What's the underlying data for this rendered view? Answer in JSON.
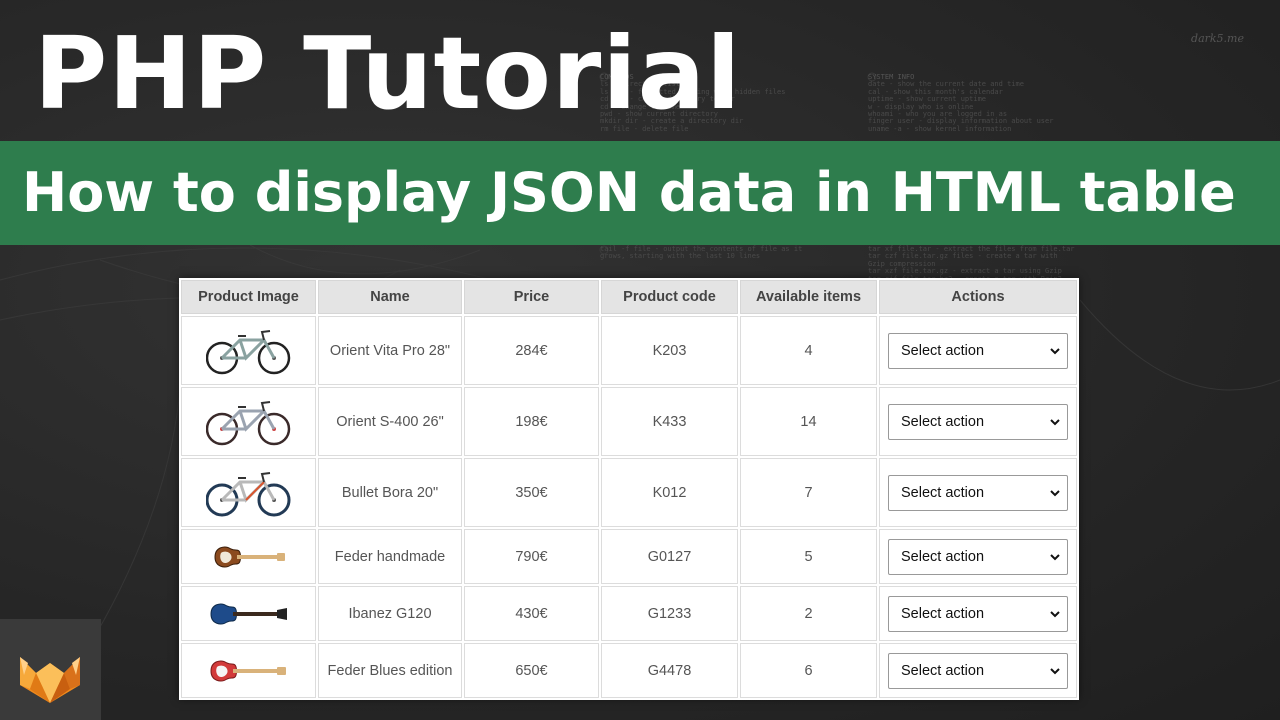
{
  "header": {
    "title": "PHP Tutorial",
    "subtitle": "How to display JSON data in HTML table",
    "banner_color": "#2e7d4d",
    "watermark": "dark5.me"
  },
  "background_cheatsheet": {
    "left_heading": "COMMANDS",
    "left_lines": [
      "ls - directory listing",
      "ls -al - formatted listing with hidden files",
      "cd dir - change directory to dir",
      "cd - change to home",
      "pwd - show current directory",
      "mkdir dir - create a directory dir",
      "rm file - delete file"
    ],
    "right_heading": "SYSTEM INFO",
    "right_lines": [
      "date - show the current date and time",
      "cal - show this month's calendar",
      "uptime - show current uptime",
      "w - display who is online",
      "whoami - who you are logged in as",
      "finger user - display information about user",
      "uname -a - show kernel information"
    ],
    "low_left_lines": [
      "tail -f file - output the contents of file as it",
      "grows, starting with the last 10 lines"
    ],
    "low_right_lines": [
      "tar xf file.tar - extract the files from file.tar",
      "tar czf file.tar.gz files - create a tar with",
      "Gzip compression",
      "tar xzf file.tar.gz - extract a tar using Gzip",
      "tar cjf file.tar.bz2 - create a tar with Bzip2"
    ]
  },
  "table": {
    "headers": [
      "Product Image",
      "Name",
      "Price",
      "Product code",
      "Available items",
      "Actions"
    ],
    "rows": [
      {
        "image": "bicycle-image",
        "name": "Orient Vita Pro 28\"",
        "price": "284€",
        "code": "K203",
        "items": "4",
        "action": "Select action"
      },
      {
        "image": "bicycle-image",
        "name": "Orient S-400 26\"",
        "price": "198€",
        "code": "K433",
        "items": "14",
        "action": "Select action"
      },
      {
        "image": "bicycle-image",
        "name": "Bullet Bora 20\"",
        "price": "350€",
        "code": "K012",
        "items": "7",
        "action": "Select action"
      },
      {
        "image": "guitar-image",
        "name": "Feder handmade",
        "price": "790€",
        "code": "G0127",
        "items": "5",
        "action": "Select action"
      },
      {
        "image": "guitar-image",
        "name": "Ibanez G120",
        "price": "430€",
        "code": "G1233",
        "items": "2",
        "action": "Select action"
      },
      {
        "image": "guitar-image",
        "name": "Feder Blues edition",
        "price": "650€",
        "code": "G4478",
        "items": "6",
        "action": "Select action"
      }
    ]
  },
  "colors": {
    "bike1": "#8aa2a0",
    "bike2": "#9aa3b0",
    "bike3": "#b9b9b9",
    "guitar1": "#8b4a1e",
    "guitar2": "#1e4b8a",
    "guitar3": "#d23a3a"
  },
  "logo": "fox-logo"
}
